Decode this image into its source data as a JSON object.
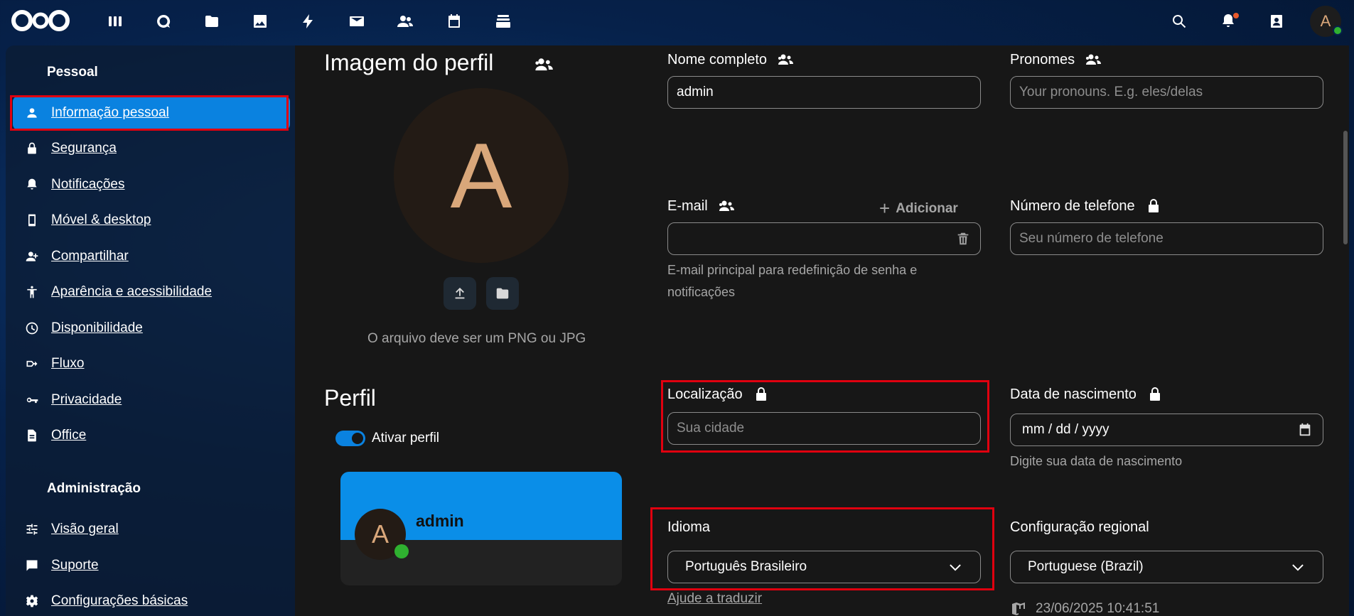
{
  "topbar": {
    "apps": [
      "dashboard-icon",
      "talk-icon",
      "files-icon",
      "photos-icon",
      "activity-icon",
      "mail-icon",
      "contacts-icon",
      "calendar-icon",
      "deck-icon"
    ],
    "avatar_letter": "A"
  },
  "sidebar": {
    "section_personal": "Pessoal",
    "personal_items": [
      {
        "label": "Informação pessoal",
        "icon": "person-icon"
      },
      {
        "label": "Segurança",
        "icon": "lock-icon"
      },
      {
        "label": "Notificações",
        "icon": "bell-icon"
      },
      {
        "label": "Móvel & desktop",
        "icon": "phone-icon"
      },
      {
        "label": "Compartilhar",
        "icon": "share-icon"
      },
      {
        "label": "Aparência e acessibilidade",
        "icon": "accessibility-icon"
      },
      {
        "label": "Disponibilidade",
        "icon": "clock-icon"
      },
      {
        "label": "Fluxo",
        "icon": "flow-icon"
      },
      {
        "label": "Privacidade",
        "icon": "key-icon"
      },
      {
        "label": "Office",
        "icon": "document-icon"
      }
    ],
    "section_admin": "Administração",
    "admin_items": [
      {
        "label": "Visão geral",
        "icon": "tune-icon"
      },
      {
        "label": "Suporte",
        "icon": "chat-icon"
      },
      {
        "label": "Configurações básicas",
        "icon": "gear-icon"
      }
    ]
  },
  "profile_picture": {
    "title": "Imagem do perfil",
    "avatar_letter": "A",
    "hint": "O arquivo deve ser um PNG ou JPG"
  },
  "profile": {
    "title": "Perfil",
    "toggle_label": "Ativar perfil",
    "card_name": "admin",
    "card_avatar_letter": "A"
  },
  "fields": {
    "full_name": {
      "label": "Nome completo",
      "value": "admin"
    },
    "pronouns": {
      "label": "Pronomes",
      "placeholder": "Your pronouns. E.g. eles/delas"
    },
    "email": {
      "label": "E-mail",
      "add_label": "Adicionar",
      "value": "",
      "hint": "E-mail principal para redefinição de senha e notificações"
    },
    "phone": {
      "label": "Número de telefone",
      "placeholder": "Seu número de telefone"
    },
    "location": {
      "label": "Localização",
      "placeholder": "Sua cidade"
    },
    "birthdate": {
      "label": "Data de nascimento",
      "placeholder": "mm / dd / yyyy",
      "hint": "Digite sua data de nascimento"
    },
    "language": {
      "label": "Idioma",
      "value": "Português Brasileiro",
      "help_link": "Ajude a traduzir"
    },
    "locale": {
      "label": "Configuração regional",
      "value": "Portuguese (Brazil)",
      "time": "23/06/2025 10:41:51"
    }
  },
  "colors": {
    "accent": "#0a82e0",
    "highlight": "#e0000f",
    "online": "#2fb130"
  }
}
